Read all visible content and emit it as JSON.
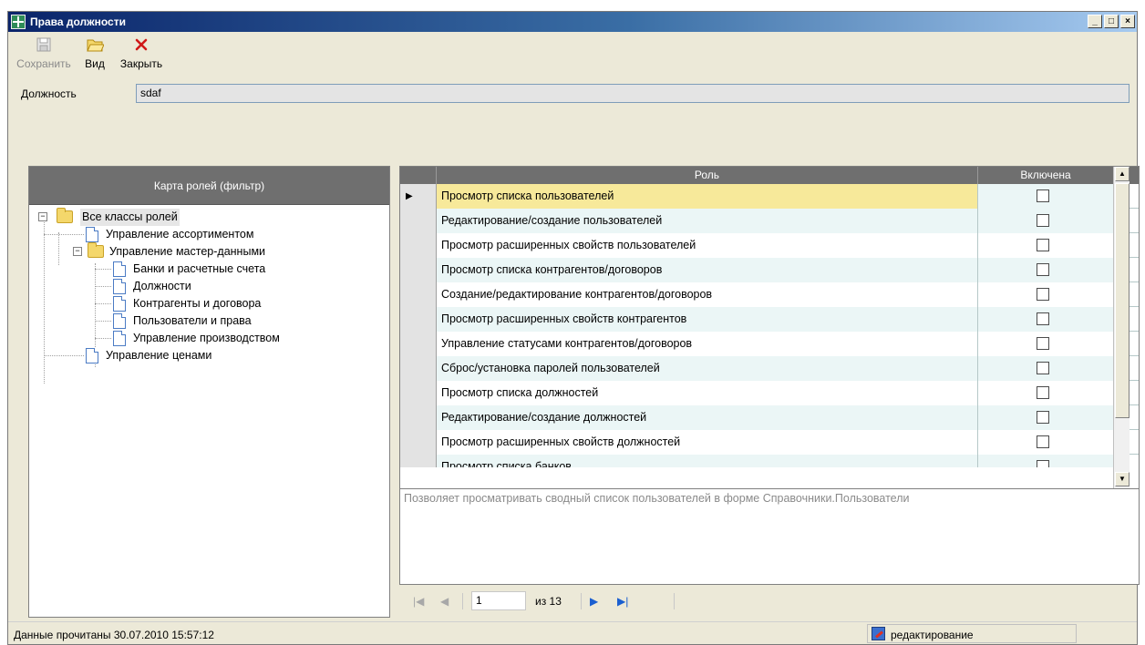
{
  "window": {
    "title": "Права должности"
  },
  "toolbar": {
    "save_label": "Сохранить",
    "view_label": "Вид",
    "close_label": "Закрыть"
  },
  "form": {
    "position_label": "Должность",
    "position_value": "sdaf"
  },
  "tree": {
    "header": "Карта ролей (фильтр)",
    "root": "Все классы ролей",
    "items": [
      "Управление ассортиментом",
      "Управление мастер-данными",
      "Банки и расчетные счета",
      "Должности",
      "Контрагенты и договора",
      "Пользователи и права",
      "Управление производством",
      "Управление ценами"
    ]
  },
  "grid": {
    "columns": [
      "Роль",
      "Включена"
    ],
    "rows": [
      {
        "role": "Просмотр списка пользователей",
        "enabled": false
      },
      {
        "role": "Редактирование/создание пользователей",
        "enabled": false
      },
      {
        "role": "Просмотр расширенных свойств пользователей",
        "enabled": false
      },
      {
        "role": "Просмотр списка контрагентов/договоров",
        "enabled": false
      },
      {
        "role": "Создание/редактирование контрагентов/договоров",
        "enabled": false
      },
      {
        "role": "Просмотр расширенных свойств контрагентов",
        "enabled": false
      },
      {
        "role": "Управление статусами контрагентов/договоров",
        "enabled": false
      },
      {
        "role": "Сброс/установка паролей пользователей",
        "enabled": false
      },
      {
        "role": "Просмотр списка должностей",
        "enabled": false
      },
      {
        "role": "Редактирование/создание должностей",
        "enabled": false
      },
      {
        "role": "Просмотр расширенных свойств должностей",
        "enabled": false
      },
      {
        "role": "Просмотр списка банков",
        "enabled": false
      }
    ],
    "description": "Позволяет просматривать сводный список пользователей в форме Справочники.Пользователи"
  },
  "pager": {
    "page": "1",
    "of_label": "из 13"
  },
  "status": {
    "text": "Данные прочитаны 30.07.2010 15:57:12",
    "mode": "редактирование"
  }
}
